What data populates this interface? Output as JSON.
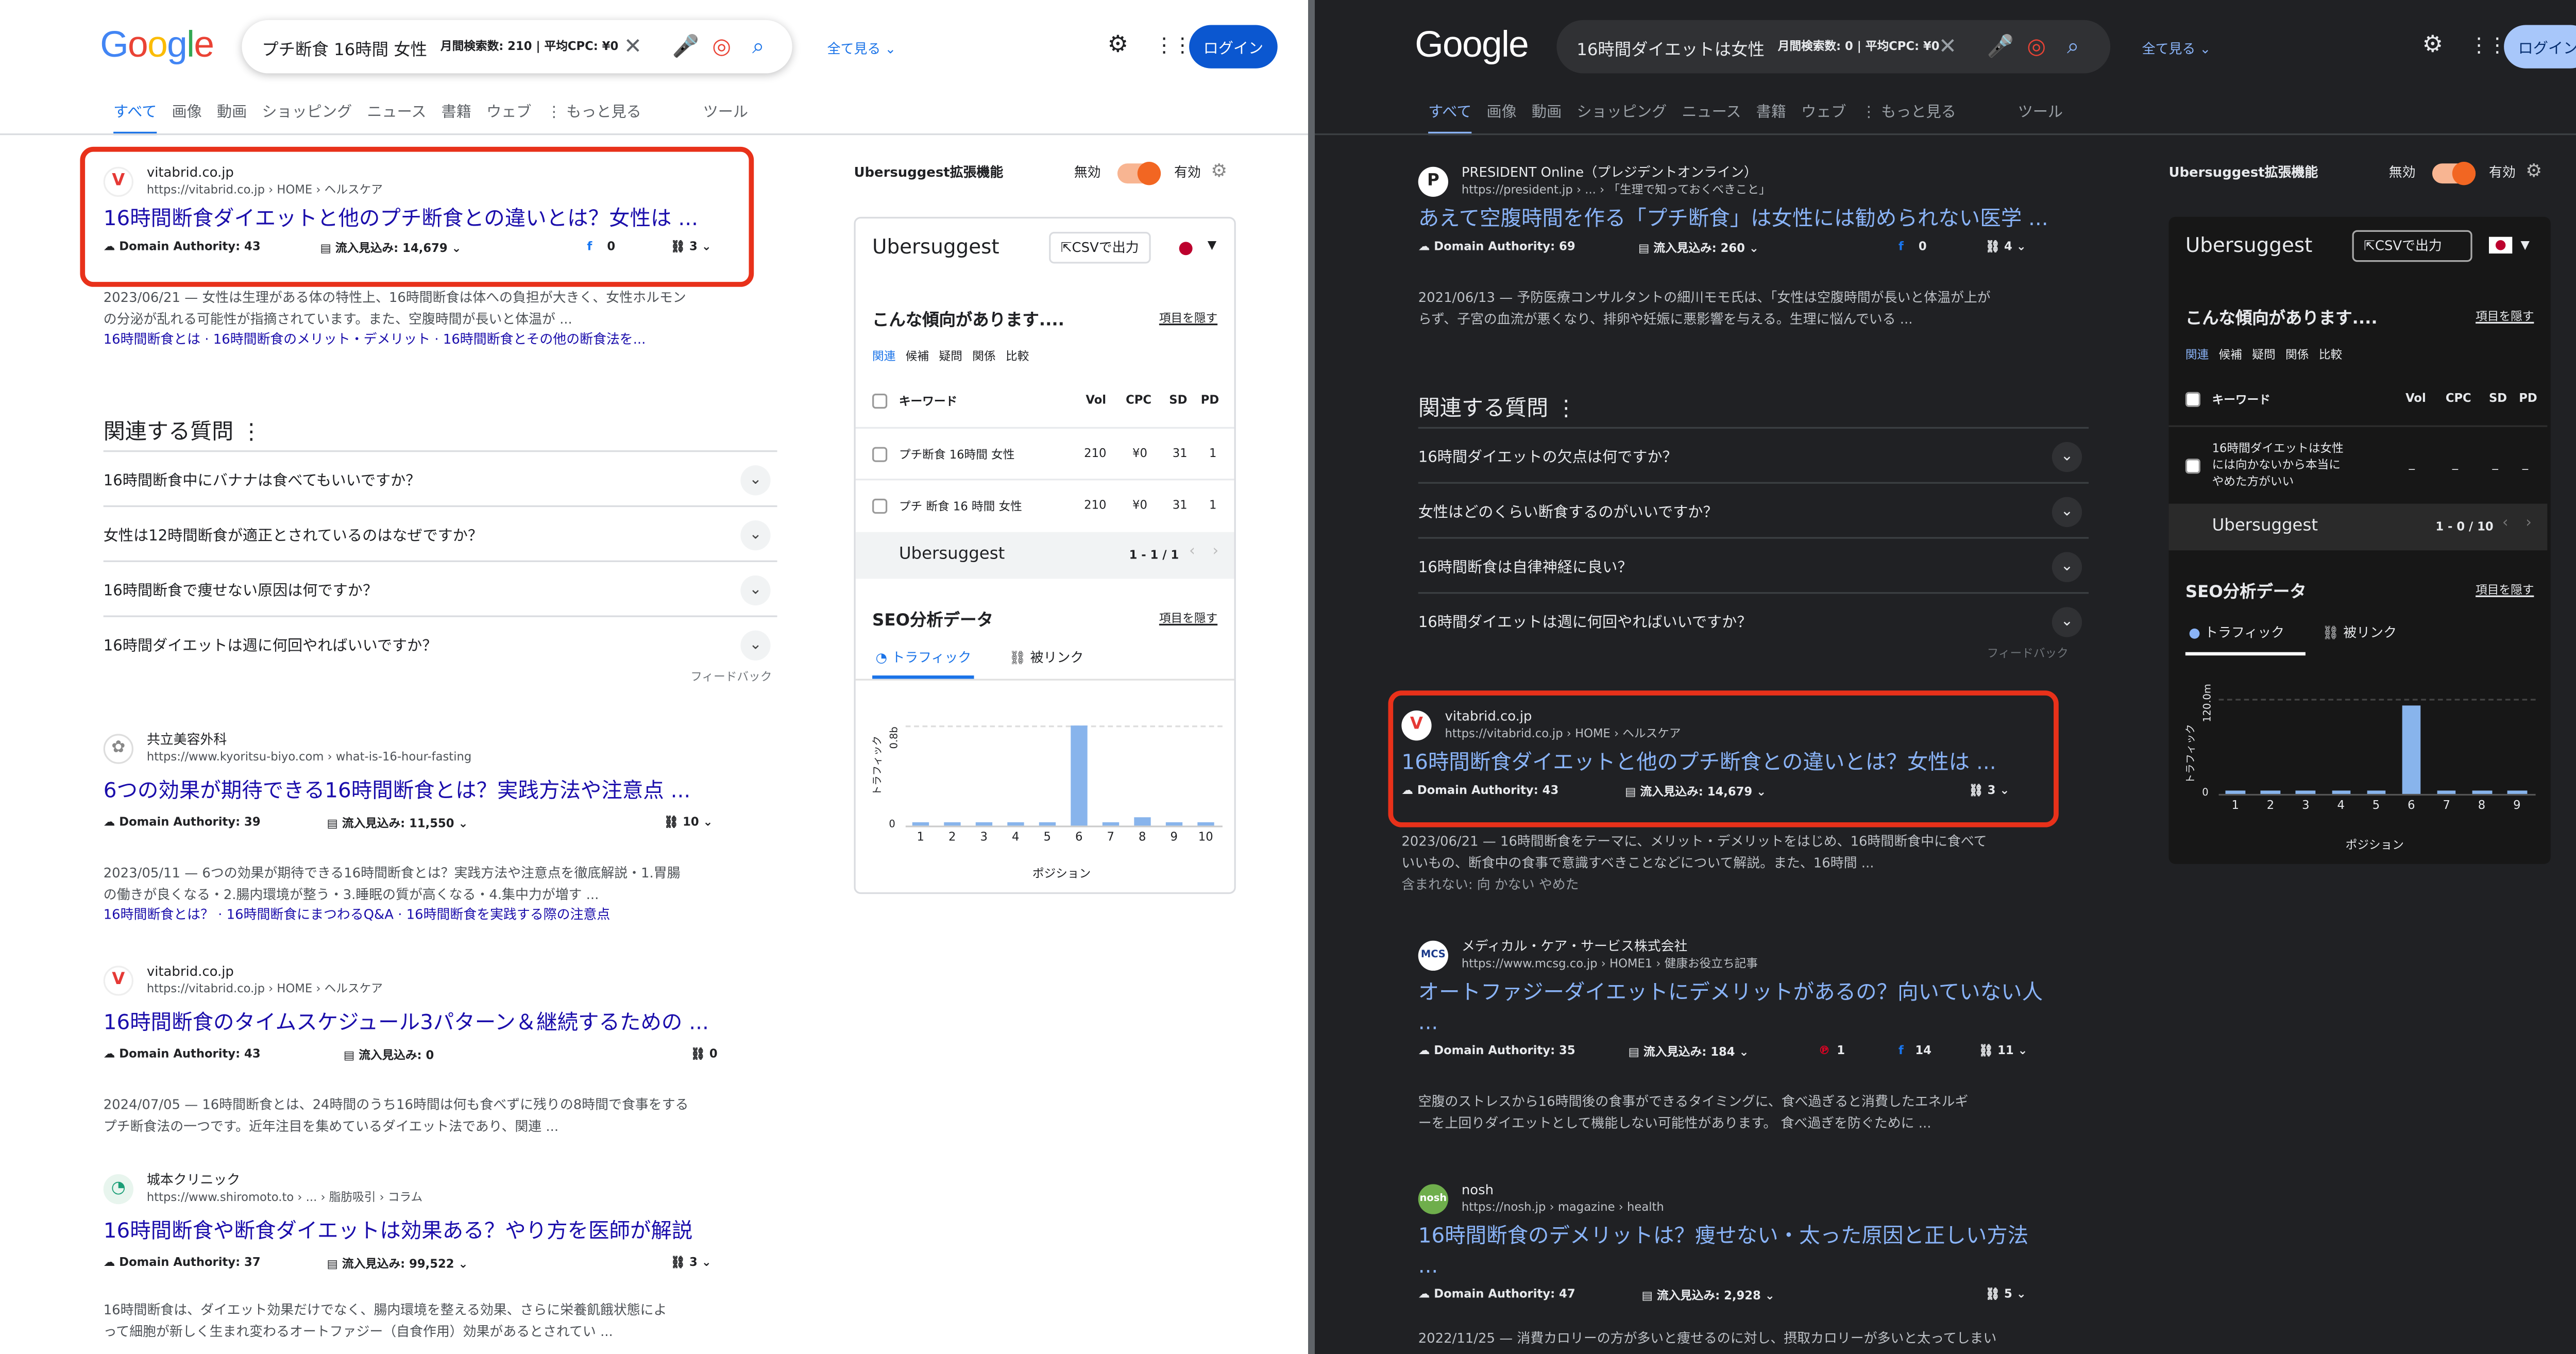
{
  "colors": {
    "accent_light": "#1a73e8",
    "accent_dark": "#8ab4f8",
    "highlight_box": "#e8311a",
    "ubersuggest_orange": "#f26622",
    "chart_bar": "#88b4ec"
  },
  "google_logo": "Google",
  "common": {
    "all_view": "全て見る",
    "login": "ログイン",
    "tabs": [
      "すべて",
      "画像",
      "動画",
      "ショッピング",
      "ニュース",
      "書籍",
      "ウェブ",
      "⋮ もっと見る"
    ],
    "tools": "ツール",
    "da_label": "Domain Authority:",
    "traffic_label": "流入見込み:",
    "paa_title": "関連する質問",
    "feedback": "フィードバック",
    "ext_title": "Ubersuggest拡張機能",
    "toggle_off": "無効",
    "toggle_on": "有効",
    "uber_title": "Ubersuggest",
    "csv_button": "CSVで出力",
    "trend_title": "こんな傾向があります....",
    "hide_item": "項目を隠す",
    "subtabs": [
      "関連",
      "候補",
      "疑問",
      "関係",
      "比較"
    ],
    "cols": {
      "keyword": "キーワード",
      "vol": "Vol",
      "cpc": "CPC",
      "sd": "SD",
      "pd": "PD"
    },
    "pager_label": "Ubersuggest",
    "seo_title": "SEO分析データ",
    "tab_traffic": "トラフィック",
    "tab_backlinks": "被リンク",
    "chart_ylabel": "トラフィック",
    "chart_xlabel": "ポジション"
  },
  "light": {
    "query": "プチ断食 16時間 女性",
    "search_meta": "月間検索数: 210 | 平均CPC: ¥0",
    "results": [
      {
        "site": "vitabrid.co.jp",
        "url": "https://vitabrid.co.jp › HOME › ヘルスケア",
        "title": "16時間断食ダイエットと他のプチ断食との違いとは？女性は ...",
        "da": "43",
        "traffic": "14,679",
        "fb": "0",
        "links": "3"
      },
      {
        "site": "共立美容外科",
        "url": "https://www.kyoritsu-biyo.com › what-is-16-hour-fasting",
        "title": "6つの効果が期待できる16時間断食とは？実践方法や注意点 ...",
        "da": "39",
        "traffic": "11,550",
        "links": "10"
      },
      {
        "site": "vitabrid.co.jp",
        "url": "https://vitabrid.co.jp › HOME › ヘルスケア",
        "title": "16時間断食のタイムスケジュール3パターン＆継続するための ...",
        "da": "43",
        "traffic": "0",
        "links": "0"
      },
      {
        "site": "城本クリニック",
        "url": "https://www.shiromoto.to › ... › 脂肪吸引 › コラム",
        "title": "16時間断食や断食ダイエットは効果ある？やり方を医師が解説",
        "da": "37",
        "traffic": "99,522",
        "links": "3"
      }
    ],
    "snippets": [
      [
        "2023/06/21 — 女性は生理がある体の特性上、16時間断食は体への負担が大きく、女性ホルモン",
        "の分泌が乱れる可能性が指摘されています。また、空腹時間が長いと体温が ..."
      ],
      [
        "2023/05/11 — 6つの効果が期待できる16時間断食とは？実践方法や注意点を徹底解説・1.胃腸",
        "の働きが良くなる・2.腸内環境が整う・3.睡眠の質が高くなる・4.集中力が増す ..."
      ],
      [
        "2024/07/05 — 16時間断食とは、24時間のうち16時間は何も食べずに残りの8時間で食事をする",
        "プチ断食法の一つです。近年注目を集めているダイエット法であり、関連 ..."
      ],
      [
        "16時間断食は、ダイエット効果だけでなく、腸内環境を整える効果、さらに栄養飢餓状態によ",
        "って細胞が新しく生まれ変わるオートファジー（自食作用）効果があるとされてい ..."
      ]
    ],
    "sublinks": [
      "16時間断食とは · 16時間断食のメリット・デメリット · 16時間断食とその他の断食法を...",
      "16時間断食とは？ · 16時間断食にまつわるQ&A · 16時間断食を実践する際の注意点"
    ],
    "paa": [
      "16時間断食中にバナナは食べてもいいですか？",
      "女性は12時間断食が適正とされているのはなぜですか？",
      "16時間断食で痩せない原因は何ですか？",
      "16時間ダイエットは週に何回やればいいですか？"
    ],
    "keywords": [
      {
        "kw": "プチ断食 16時間 女性",
        "vol": "210",
        "cpc": "¥0",
        "sd": "31",
        "pd": "1"
      },
      {
        "kw": "プチ 断食 16 時間 女性",
        "vol": "210",
        "cpc": "¥0",
        "sd": "31",
        "pd": "1"
      }
    ],
    "pager": "1 - 1 / 1"
  },
  "dark": {
    "query": "16時間ダイエットは女性",
    "search_meta": "月間検索数: 0 | 平均CPC: ¥0",
    "results": [
      {
        "site": "PRESIDENT Online（プレジデントオンライン）",
        "url": "https://president.jp › ... › 「生理で知っておくべきこと」",
        "title": "あえて空腹時間を作る「プチ断食」は女性には勧められない医学 ...",
        "da": "69",
        "traffic": "260",
        "fb": "0",
        "links": "4"
      },
      {
        "site": "vitabrid.co.jp",
        "url": "https://vitabrid.co.jp › HOME › ヘルスケア",
        "title": "16時間断食ダイエットと他のプチ断食との違いとは？女性は ...",
        "da": "43",
        "traffic": "14,679",
        "links": "3"
      },
      {
        "site": "メディカル・ケア・サービス株式会社",
        "url": "https://www.mcsg.co.jp › HOME1 › 健康お役立ち記事",
        "title": "オートファジーダイエットにデメリットがあるの？向いていない人",
        "da": "35",
        "traffic": "184",
        "pin": "1",
        "fb": "14",
        "links": "11"
      },
      {
        "site": "nosh",
        "url": "https://nosh.jp › magazine › health",
        "title": "16時間断食のデメリットは？痩せない・太った原因と正しい方法",
        "da": "47",
        "traffic": "2,928",
        "links": "5"
      }
    ],
    "snippets": [
      [
        "2021/06/13 — 予防医療コンサルタントの細川モモ氏は、「女性は空腹時間が長いと体温が上が",
        "らず、子宮の血流が悪くなり、排卵や妊娠に悪影響を与える。生理に悩んでいる ..."
      ],
      [
        "2023/06/21 — 16時間断食をテーマに、メリット・デメリットをはじめ、16時間断食中に食べて",
        "いいもの、断食中の食事で意識すべきことなどについて解説。また、16時間 ..."
      ],
      [
        "空腹のストレスから16時間後の食事ができるタイミングに、食べ過ぎると消費したエネルギ",
        "ーを上回りダイエットとして機能しない可能性があります。 食べ過ぎを防ぐために ..."
      ],
      [
        "2022/11/25 — 消費カロリーの方が多いと痩せるのに対し、摂取カロリーが多いと太ってしまい",
        ""
      ]
    ],
    "missing_note": "含まれない: 向 かない やめた",
    "paa": [
      "16時間ダイエットの欠点は何ですか？",
      "女性はどのくらい断食するのがいいですか？",
      "16時間断食は自律神経に良い？",
      "16時間ダイエットは週に何回やればいいですか？"
    ],
    "keywords": [
      {
        "kw": "16時間ダイエットは女性には向かないから本当にやめた方がいい",
        "vol": "_",
        "cpc": "_",
        "sd": "_",
        "pd": "_"
      }
    ],
    "pager": "1 - 0 / 10"
  },
  "chart_data": [
    {
      "type": "bar",
      "title": "SEO分析データ",
      "xlabel": "ポジション",
      "ylabel": "トラフィック",
      "categories": [
        "1",
        "2",
        "3",
        "4",
        "5",
        "6",
        "7",
        "8",
        "9",
        "10"
      ],
      "values": [
        0.02,
        0.02,
        0.02,
        0.02,
        0.02,
        0.8,
        0.02,
        0.06,
        0.02,
        0.02
      ],
      "ytick": "0.8b",
      "ylim": [
        0,
        0.9
      ]
    },
    {
      "type": "bar",
      "title": "SEO分析データ",
      "xlabel": "ポジション",
      "ylabel": "トラフィック",
      "categories": [
        "1",
        "2",
        "3",
        "4",
        "5",
        "6",
        "7",
        "8",
        "9"
      ],
      "values": [
        2,
        2,
        2,
        2,
        2,
        100,
        2,
        2,
        2
      ],
      "ytick": "120.0m",
      "ylim": [
        0,
        120
      ]
    }
  ]
}
